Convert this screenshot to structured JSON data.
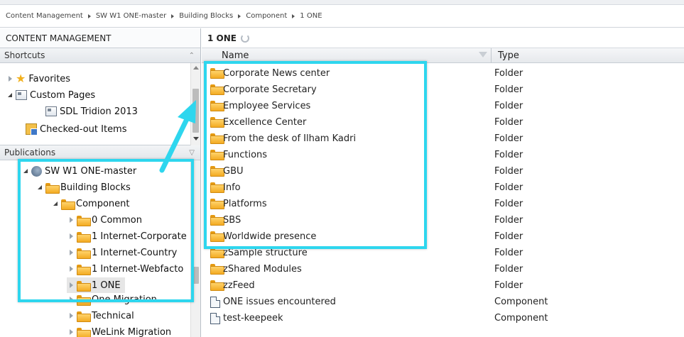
{
  "breadcrumb": [
    "Content Management",
    "SW W1 ONE-master",
    "Building Blocks",
    "Component",
    "1 ONE"
  ],
  "left_panel": {
    "title": "CONTENT MANAGEMENT",
    "shortcuts": {
      "header": "Shortcuts",
      "items": [
        "Favorites",
        "Custom Pages",
        "SDL Tridion 2013",
        "Checked-out Items"
      ]
    },
    "publications": {
      "header": "Publications",
      "items": [
        "SW W1 ONE-master",
        "Building Blocks",
        "Component",
        "0 Common",
        "1 Internet-Corporate",
        "1 Internet-Country",
        "1 Internet-Webfacto",
        "1 ONE",
        "One Migration",
        "Technical",
        "WeLink Migration"
      ]
    }
  },
  "right_panel": {
    "title": "1 ONE",
    "columns": {
      "name": "Name",
      "type": "Type"
    },
    "rows": [
      {
        "name": "Corporate News center",
        "type": "Folder",
        "icon": "folder-icon"
      },
      {
        "name": "Corporate Secretary",
        "type": "Folder",
        "icon": "folder-icon"
      },
      {
        "name": "Employee Services",
        "type": "Folder",
        "icon": "folder-icon"
      },
      {
        "name": "Excellence Center",
        "type": "Folder",
        "icon": "folder-icon"
      },
      {
        "name": "From the desk of Ilham Kadri",
        "type": "Folder",
        "icon": "folder-icon"
      },
      {
        "name": "Functions",
        "type": "Folder",
        "icon": "folder-icon"
      },
      {
        "name": "GBU",
        "type": "Folder",
        "icon": "folder-icon"
      },
      {
        "name": "Info",
        "type": "Folder",
        "icon": "folder-icon"
      },
      {
        "name": "Platforms",
        "type": "Folder",
        "icon": "folder-icon"
      },
      {
        "name": "SBS",
        "type": "Folder",
        "icon": "folder-icon"
      },
      {
        "name": "Worldwide presence",
        "type": "Folder",
        "icon": "folder-icon"
      },
      {
        "name": "zSample structure",
        "type": "Folder",
        "icon": "folder-icon"
      },
      {
        "name": "zShared Modules",
        "type": "Folder",
        "icon": "folder-icon"
      },
      {
        "name": "zzFeed",
        "type": "Folder",
        "icon": "folder-icon"
      },
      {
        "name": "ONE issues encountered",
        "type": "Component",
        "icon": "component-icon"
      },
      {
        "name": "test-keepeek",
        "type": "Component",
        "icon": "component-icon"
      }
    ]
  },
  "annotation": {
    "highlight_color": "#2ed6ee"
  }
}
